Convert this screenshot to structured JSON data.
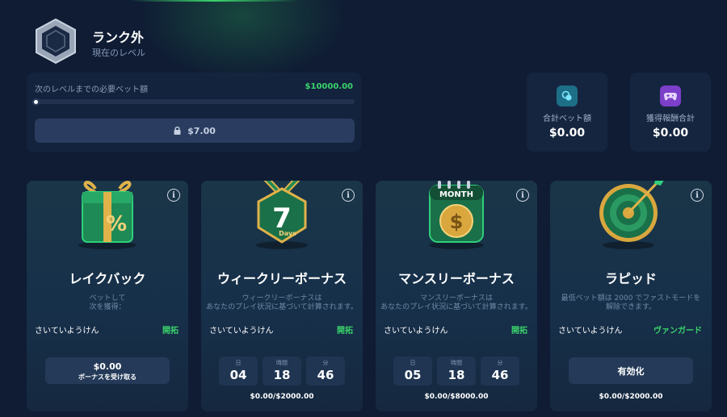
{
  "rank": {
    "title": "ランク外",
    "subtitle": "現在のレベル"
  },
  "progress": {
    "label": "次のレベルまでの必要ベット額",
    "target": "$10000.00",
    "fraction": 0,
    "current": "$7.00"
  },
  "stats": [
    {
      "label": "合計ベット額",
      "value": "$0.00",
      "icon": "coins-icon",
      "icon_color": "#1c6f86"
    },
    {
      "label": "獲得報酬合計",
      "value": "$0.00",
      "icon": "gamepad-icon",
      "icon_color": "#7b3fc9"
    }
  ],
  "cards": [
    {
      "title": "レイクバック",
      "desc": "ベットして\n次を獲得：",
      "user": "さいていようけん",
      "rank": "開拓",
      "button_amount": "$0.00",
      "button_label": "ボーナスを受け取る",
      "art": "gift-percent-icon"
    },
    {
      "title": "ウィークリーボーナス",
      "desc": "ウィークリーボーナスは\nあなたのプレイ状況に基づいて計算されます。",
      "user": "さいていようけん",
      "rank": "開拓",
      "timer": [
        {
          "label": "日",
          "value": "04"
        },
        {
          "label": "時間",
          "value": "18"
        },
        {
          "label": "分",
          "value": "46"
        }
      ],
      "footer": "$0.00/$2000.00",
      "art": "medal-7days-icon",
      "art_text": "7",
      "art_sub": "Days"
    },
    {
      "title": "マンスリーボーナス",
      "desc": "マンスリーボーナスは\nあなたのプレイ状況に基づいて計算されます。",
      "user": "さいていようけん",
      "rank": "開拓",
      "timer": [
        {
          "label": "日",
          "value": "05"
        },
        {
          "label": "時間",
          "value": "18"
        },
        {
          "label": "分",
          "value": "46"
        }
      ],
      "footer": "$0.00/$8000.00",
      "art": "calendar-dollar-icon",
      "art_text": "MONTH"
    },
    {
      "title": "ラピッド",
      "desc": "最低ベット額は 2000 でファストモードを\n解除できます。",
      "user": "さいていようけん",
      "rank": "ヴァンガード",
      "button_label": "有効化",
      "footer": "$0.00/$2000.00",
      "art": "dartboard-icon"
    }
  ],
  "colors": {
    "accent": "#3ad36b",
    "bg": "#0f1c34",
    "card": "#1a3548"
  }
}
